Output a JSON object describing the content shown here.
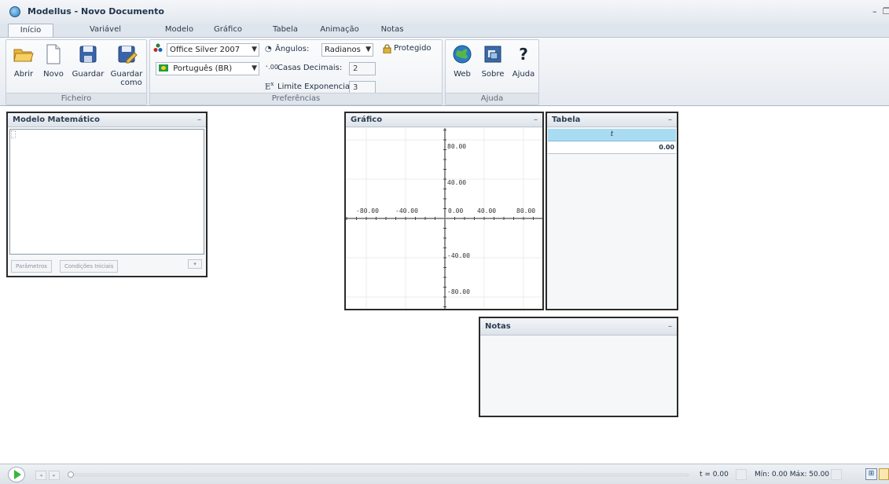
{
  "window": {
    "title": "Modellus - Novo Documento",
    "controls": [
      "–",
      "❐"
    ]
  },
  "tabs": [
    {
      "label": "Início",
      "active": true
    },
    {
      "label": "Variável Independente"
    },
    {
      "label": "Modelo"
    },
    {
      "label": "Gráfico"
    },
    {
      "label": "Tabela"
    },
    {
      "label": "Animação"
    },
    {
      "label": "Notas"
    }
  ],
  "ribbon": {
    "ficheiro": {
      "caption": "Ficheiro",
      "buttons": [
        {
          "label": "Abrir",
          "icon": "folder-open-icon"
        },
        {
          "label": "Novo",
          "icon": "new-document-icon"
        },
        {
          "label": "Guardar",
          "icon": "save-icon"
        },
        {
          "label": "Guardar",
          "label2": "como",
          "icon": "save-as-icon"
        }
      ]
    },
    "preferencias": {
      "caption": "Preferências",
      "theme": "Office Silver 2007",
      "language": "Português (BR)",
      "angles_label": "Ângulos:",
      "angles_value": "Radianos",
      "protected_label": "Protegido",
      "decimals_label": "Casas Decimais:",
      "decimals_value": "2",
      "exp_label": "Limite Exponencial:",
      "exp_value": "3"
    },
    "ajuda": {
      "caption": "Ajuda",
      "buttons": [
        {
          "label": "Web",
          "icon": "globe-icon"
        },
        {
          "label": "Sobre",
          "icon": "about-icon"
        },
        {
          "label": "Ajuda",
          "icon": "help-icon",
          "glyph": "?"
        }
      ]
    }
  },
  "panels": {
    "modelo": {
      "title": "Modelo Matemático",
      "btn_params": "Parâmetros",
      "btn_init": "Condições Iniciais"
    },
    "grafico": {
      "title": "Gráfico",
      "x_ticks": [
        "-80.00",
        "-40.00",
        "0.00",
        "40.00",
        "80.00"
      ],
      "y_ticks": [
        "80.00",
        "40.00",
        "-40.00",
        "-80.00"
      ]
    },
    "tabela": {
      "title": "Tabela",
      "column": "t",
      "value": "0.00"
    },
    "notas": {
      "title": "Notas"
    }
  },
  "statusbar": {
    "t_label": "t = 0.00",
    "range_label": "Mín: 0.00 Máx: 50.00"
  },
  "colors": {
    "table_header": "#a9dcf2",
    "play": "#3ab63a"
  }
}
